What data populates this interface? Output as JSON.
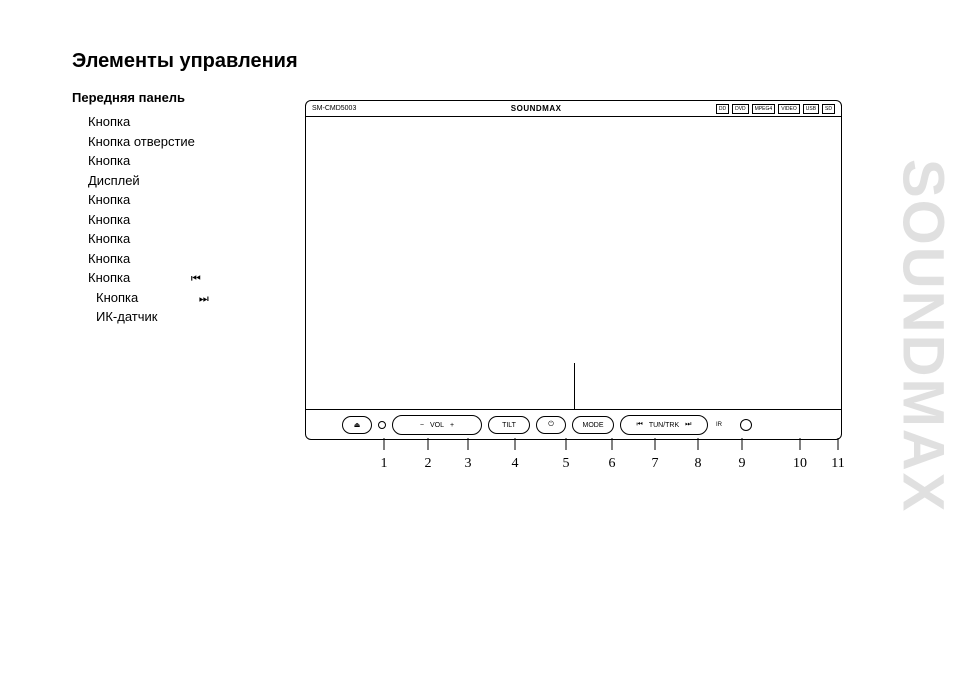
{
  "title": "Элементы управления",
  "subtitle": "Передняя панель",
  "brand_vertical": "SOUNDMAX",
  "list": {
    "i1": "Кнопка",
    "i2": "Кнопка   отверстие",
    "i3": "Кнопка",
    "i4": "Дисплей",
    "i5": "Кнопка",
    "i6": "Кнопка",
    "i7": "Кнопка",
    "i8": "Кнопка",
    "i9": "Кнопка",
    "i9_icon": "⏮",
    "i10": "Кнопка",
    "i10_icon": "⏭",
    "i11": "ИК-датчик"
  },
  "device": {
    "model": "SM-CMD5003",
    "brand": "SOUNDMAX",
    "badges": [
      "DD",
      "DVD",
      "MPEG4",
      "VIDEO",
      "USB",
      "SD"
    ],
    "ctrl": {
      "eject_icon": "⏏",
      "vol_minus": "−",
      "vol_label": "VOL",
      "vol_plus": "+",
      "tilt": "TILT",
      "power_icon": "⏻",
      "mode": "MODE",
      "prev_icon": "⏮",
      "tuntrk": "TUN/TRK",
      "next_icon": "⏭",
      "ir": "IR"
    }
  },
  "numbers": [
    "1",
    "2",
    "3",
    "4",
    "5",
    "6",
    "7",
    "8",
    "9",
    "10",
    "11"
  ],
  "number_x": [
    79,
    123,
    163,
    210,
    261,
    307,
    350,
    393,
    437,
    495,
    533
  ]
}
